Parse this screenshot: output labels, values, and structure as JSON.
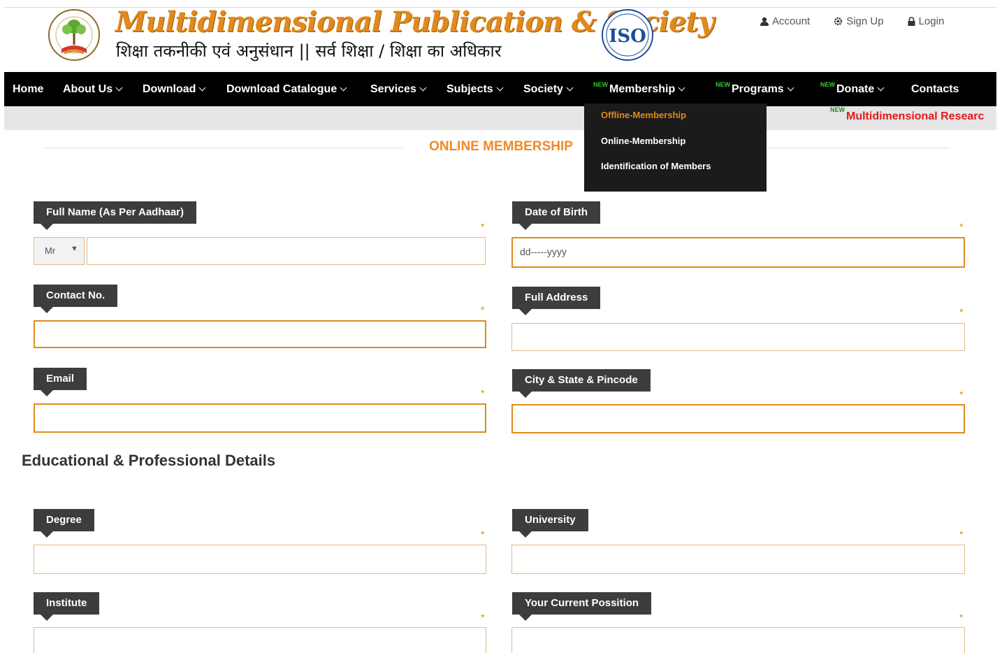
{
  "header": {
    "brand_title": "Multidimensional Publication & Society",
    "brand_tagline": "शिक्षा तकनीकी एवं अनुसंधान || सर्व शिक्षा / शिक्षा का अधिकार",
    "iso_label": "ISO",
    "top_links": {
      "account": "Account",
      "signup": "Sign Up",
      "login": "Login"
    }
  },
  "nav": {
    "home": "Home",
    "about": "About Us",
    "download": "Download",
    "catalogue": "Download Catalogue",
    "services": "Services",
    "subjects": "Subjects",
    "society": "Society",
    "membership": "Membership",
    "programs": "Programs",
    "donate": "Donate",
    "contacts": "Contacts",
    "new_tag": "NEW"
  },
  "dropdown": {
    "items": [
      "Offline-Membership",
      "Online-Membership",
      "Identification of Members"
    ]
  },
  "marquee": {
    "new_tag": "NEW",
    "text": "Multidimensional Researc"
  },
  "page": {
    "section_title": "ONLINE MEMBERSHIP",
    "edu_title": "Educational & Professional Details"
  },
  "form": {
    "fullname_label": "Full Name (As Per Aadhaar)",
    "title_value": "Mr",
    "dob_label": "Date of Birth",
    "dob_value": "dd-----yyyy",
    "contact_label": "Contact No.",
    "address_label": "Full Address",
    "email_label": "Email",
    "city_label": "City & State & Pincode",
    "degree_label": "Degree",
    "university_label": "University",
    "institute_label": "Institute",
    "position_label": "Your Current Possition",
    "required_mark": "*"
  },
  "colors": {
    "accent": "#e08a1e",
    "nav_bg": "#000000",
    "label_bg": "#3d3d3d",
    "new_tag": "#2ecc2e",
    "marquee": "#e21a1a"
  }
}
